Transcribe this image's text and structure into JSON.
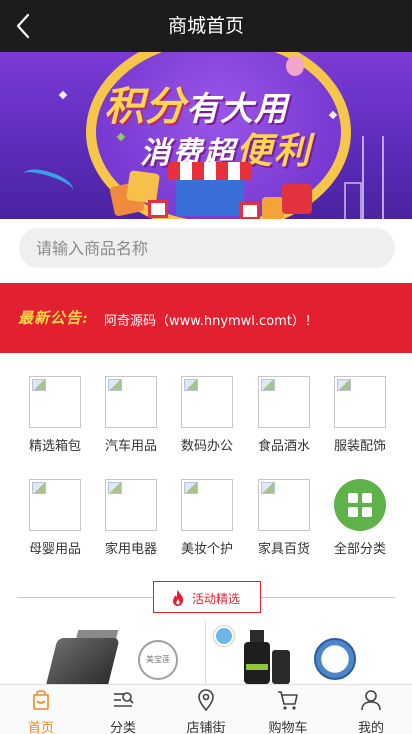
{
  "header": {
    "title": "商城首页",
    "back_icon": "chevron-left-icon"
  },
  "banner": {
    "line1_main": "积分",
    "line1_rest": "有大用",
    "line2_main": "消费超",
    "line2_emph": "便利"
  },
  "search": {
    "placeholder": "请输入商品名称",
    "value": ""
  },
  "notice": {
    "tag": "最新公告:",
    "text": "阿奇源码（www.hnymwl.comt）！"
  },
  "categories": [
    {
      "label": "精选箱包",
      "icon": "broken-image-icon"
    },
    {
      "label": "汽车用品",
      "icon": "broken-image-icon"
    },
    {
      "label": "数码办公",
      "icon": "broken-image-icon"
    },
    {
      "label": "食品酒水",
      "icon": "broken-image-icon"
    },
    {
      "label": "服装配饰",
      "icon": "broken-image-icon"
    },
    {
      "label": "母婴用品",
      "icon": "broken-image-icon"
    },
    {
      "label": "家用电器",
      "icon": "broken-image-icon"
    },
    {
      "label": "美妆个护",
      "icon": "broken-image-icon"
    },
    {
      "label": "家具百货",
      "icon": "broken-image-icon"
    },
    {
      "label": "全部分类",
      "icon": "grid-icon"
    }
  ],
  "activity": {
    "label": "活动精选",
    "icon": "flame-icon"
  },
  "products": {
    "stamp_text": "美宝莲"
  },
  "tabbar": {
    "items": [
      {
        "label": "首页",
        "icon": "home-bag-icon",
        "active": true
      },
      {
        "label": "分类",
        "icon": "category-search-icon",
        "active": false
      },
      {
        "label": "店铺街",
        "icon": "location-pin-icon",
        "active": false
      },
      {
        "label": "购物车",
        "icon": "cart-icon",
        "active": false
      },
      {
        "label": "我的",
        "icon": "user-icon",
        "active": false
      }
    ]
  },
  "colors": {
    "header_bg": "#1c1c1c",
    "notice_bg": "#e2202f",
    "accent_green": "#5fb24a",
    "active_tab": "#f08a24"
  }
}
